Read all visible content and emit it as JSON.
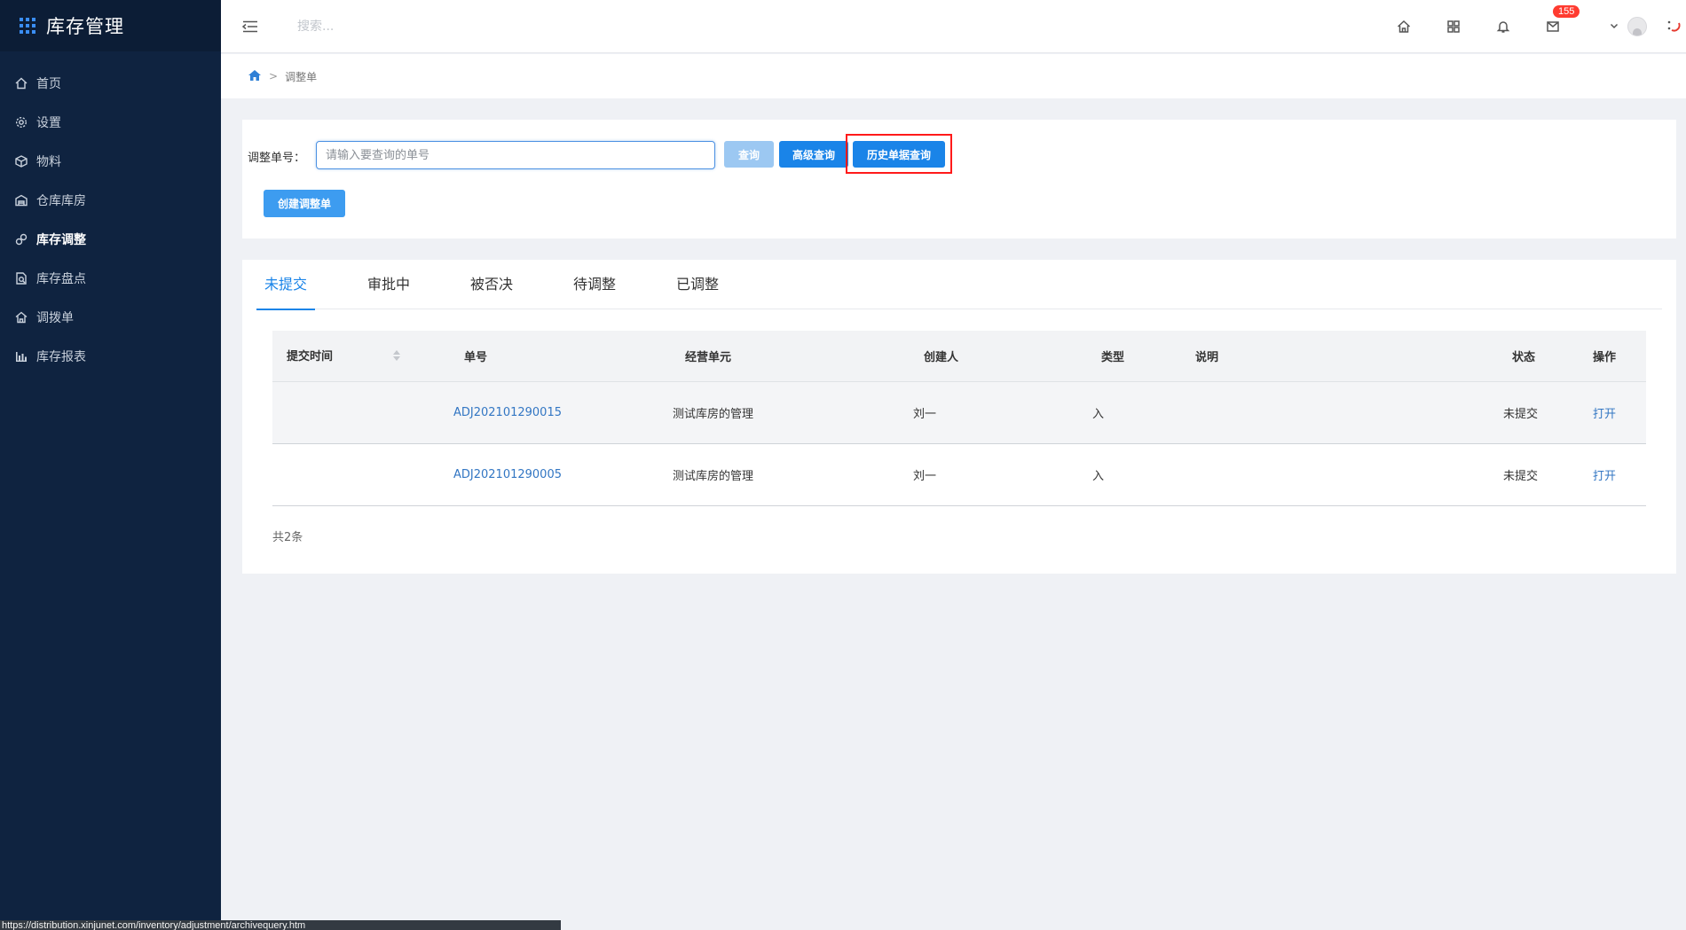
{
  "app": {
    "title": "库存管理"
  },
  "sidebar": {
    "items": [
      {
        "label": "首页",
        "icon": "home-icon"
      },
      {
        "label": "设置",
        "icon": "gear-icon"
      },
      {
        "label": "物料",
        "icon": "cube-icon"
      },
      {
        "label": "仓库库房",
        "icon": "warehouse-icon"
      },
      {
        "label": "库存调整",
        "icon": "adjust-icon",
        "active": true
      },
      {
        "label": "库存盘点",
        "icon": "inventory-check-icon"
      },
      {
        "label": "调拨单",
        "icon": "transfer-icon"
      },
      {
        "label": "库存报表",
        "icon": "bar-chart-icon"
      }
    ]
  },
  "topbar": {
    "search_placeholder": "搜索...",
    "notification_count": "155"
  },
  "breadcrumb": {
    "current": "调整单",
    "separator": ">"
  },
  "search_panel": {
    "label": "调整单号：",
    "input_placeholder": "请输入要查询的单号",
    "query_label": "查询",
    "advanced_label": "高级查询",
    "history_label": "历史单据查询",
    "create_label": "创建调整单"
  },
  "tabs": [
    {
      "label": "未提交",
      "active": true
    },
    {
      "label": "审批中"
    },
    {
      "label": "被否决"
    },
    {
      "label": "待调整"
    },
    {
      "label": "已调整"
    }
  ],
  "table": {
    "headers": {
      "submit_time": "提交时间",
      "number": "单号",
      "business_unit": "经营单元",
      "creator": "创建人",
      "type": "类型",
      "description": "说明",
      "status": "状态",
      "action": "操作"
    },
    "rows": [
      {
        "submit_time": "",
        "number": "ADJ202101290015",
        "business_unit": "测试库房的管理",
        "creator": "刘一",
        "type": "入",
        "description": "",
        "status": "未提交",
        "action": "打开"
      },
      {
        "submit_time": "",
        "number": "ADJ202101290005",
        "business_unit": "测试库房的管理",
        "creator": "刘一",
        "type": "入",
        "description": "",
        "status": "未提交",
        "action": "打开"
      }
    ],
    "total": "共2条"
  },
  "status_url": "https://distribution.xinjunet.com/inventory/adjustment/archivequery.htm",
  "colors": {
    "sidebar_bg": "#0f2340",
    "primary": "#1a84e8",
    "highlight": "#ff1a1a",
    "badge": "#ff3b30"
  }
}
